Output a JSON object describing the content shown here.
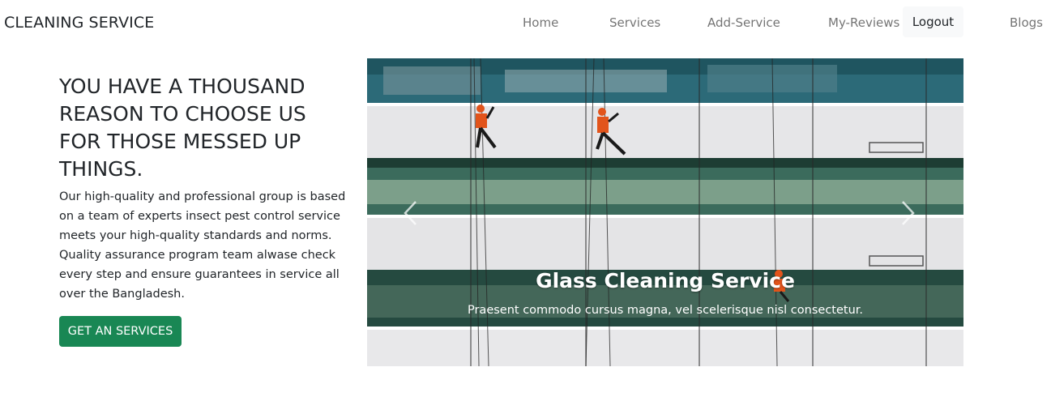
{
  "navbar": {
    "brand": "CLEANING SERVICE",
    "links": {
      "home": "Home",
      "services": "Services",
      "add_service": "Add-Service",
      "my_reviews": "My-Reviews",
      "logout": "Logout",
      "blogs": "Blogs"
    }
  },
  "hero": {
    "title": "YOU HAVE A THOUSAND REASON TO CHOOSE US FOR THOSE MESSED UP THINGS.",
    "text": "Our high-quality and professional group is based on a team of experts insect pest control service meets your high-quality standards and norms. Quality assurance program team alwase check every step and ensure guarantees in service all over the Bangladesh.",
    "cta_label": "GET AN SERVICES"
  },
  "carousel": {
    "caption_title": "Glass Cleaning Service",
    "caption_text": "Praesent commodo cursus magna, vel scelerisque nisl consectetur.",
    "prev_icon": "chevron-left-icon",
    "next_icon": "chevron-right-icon"
  },
  "colors": {
    "primary_green": "#198754",
    "nav_muted": "#6c757d",
    "logout_bg": "#f8f9fa"
  }
}
